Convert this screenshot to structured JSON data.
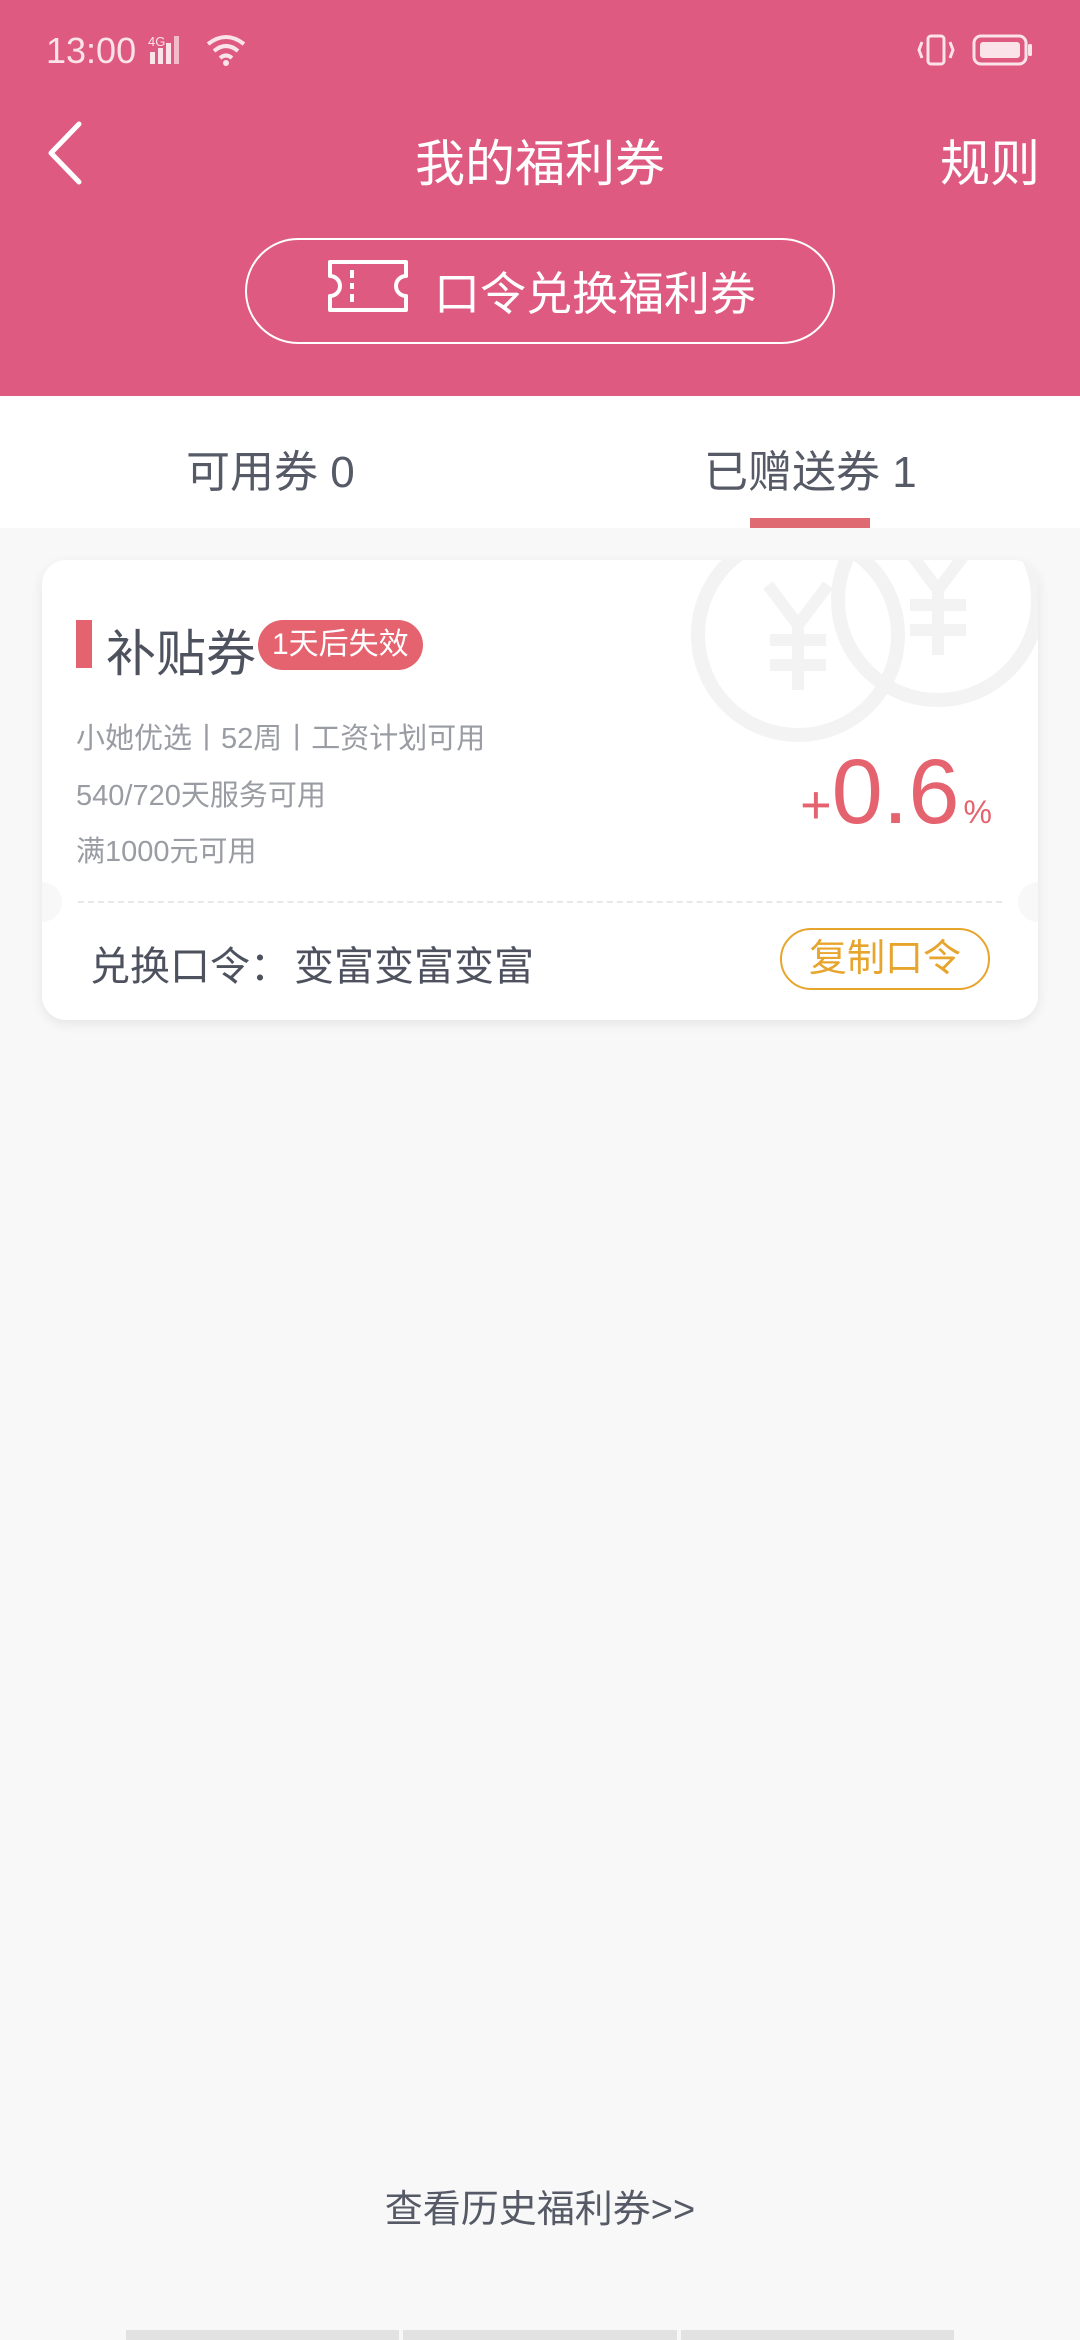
{
  "status_bar": {
    "time": "13:00",
    "network_label": "4G",
    "icons": [
      "signal-icon",
      "wifi-icon",
      "vibrate-icon",
      "battery-icon"
    ]
  },
  "header": {
    "back_icon": "back-arrow-icon",
    "title": "我的福利券",
    "rules_label": "规则",
    "redeem_button_label": "口令兑换福利券",
    "redeem_icon": "ticket-icon"
  },
  "tabs": [
    {
      "label": "可用券 0",
      "active": false
    },
    {
      "label": "已赠送券 1",
      "active": true
    }
  ],
  "coupon": {
    "title": "补贴券",
    "expiry_badge": "1天后失效",
    "desc_lines": [
      "小她优选丨52周丨工资计划可用",
      "540/720天服务可用",
      "满1000元可用"
    ],
    "rate_plus": "+",
    "rate_value": "0.6",
    "rate_percent": "%",
    "code_label": "兑换口令：",
    "code_value": "变富变富变富",
    "copy_button_label": "复制口令",
    "watermark_icon": "yen-coin-watermark-icon"
  },
  "footer": {
    "history_link": "查看历史福利券>>"
  },
  "colors": {
    "header_bg": "#df5a80",
    "accent": "#e5636e",
    "copy_button": "#e7a52e"
  }
}
